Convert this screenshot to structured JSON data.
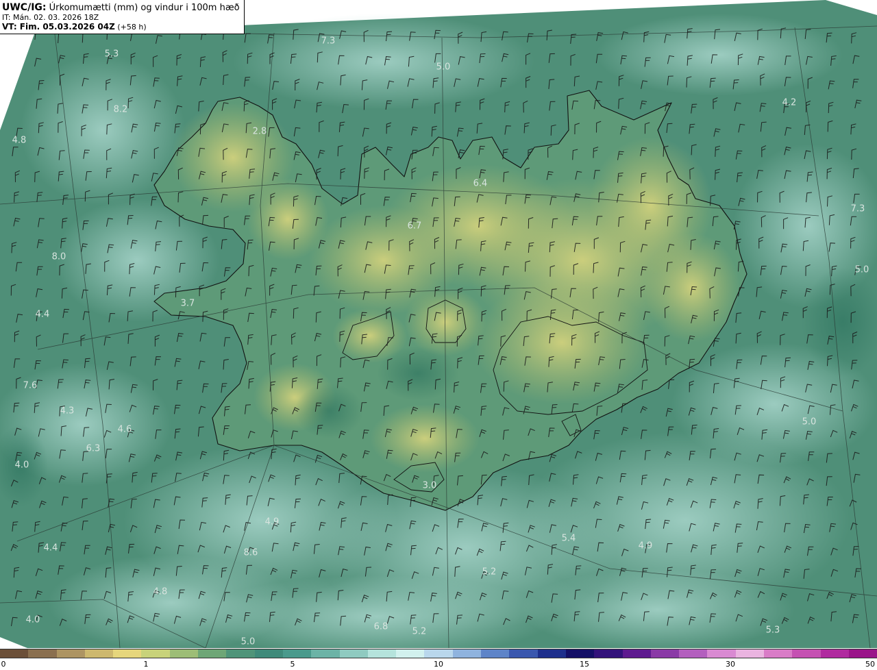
{
  "header": {
    "model": "UWC/IG:",
    "description": "Úrkomumætti (mm) og vindur i 100m hæð",
    "it_line": "IT: Mán. 02. 03. 2026 18Z",
    "vt_bold": "VT: Fim. 05.03.2026 04Z",
    "vt_suffix": "(+58 h)"
  },
  "colors": {
    "field_base": "#4f8f78",
    "field_light": "#7fb7a6",
    "land_yellow": "#a8b56a",
    "coast": "#111111",
    "label": "#d8e4df"
  },
  "precip_labels": [
    "7.3",
    "5.3",
    "5.0",
    "8.2",
    "4.2",
    "2.8",
    "4.8",
    "6.4",
    "6.7",
    "7.3",
    "8.0",
    "5.0",
    "3.7",
    "4.4",
    "7.6",
    "4.3",
    "4.6",
    "6.3",
    "5.0",
    "4.0",
    "3.0",
    "4.9",
    "5.4",
    "4.4",
    "8.6",
    "4.9",
    "5.2",
    "4.8",
    "4.0",
    "6.8",
    "5.2",
    "5.0",
    "5.3"
  ],
  "colorbar": {
    "ticks": [
      "0",
      "1",
      "5",
      "10",
      "15",
      "30",
      "50"
    ],
    "colors": [
      "#6b4f38",
      "#8a6f4f",
      "#ad9462",
      "#cdb86e",
      "#e6d67c",
      "#c8d27a",
      "#9dbd76",
      "#6ea676",
      "#4f9479",
      "#3f8a7a",
      "#4a9a8c",
      "#6cb3a6",
      "#8fcac0",
      "#b5e3dc",
      "#d2f1ee",
      "#b9d7ec",
      "#8fb3de",
      "#5e84c8",
      "#3a57ae",
      "#1e2f8c",
      "#140f66",
      "#33127a",
      "#5e1a8f",
      "#8a3aa6",
      "#b35fbe",
      "#d98ad2",
      "#eab4e0",
      "#d97cc7",
      "#c551b2",
      "#b02a9f",
      "#9a1489"
    ]
  }
}
